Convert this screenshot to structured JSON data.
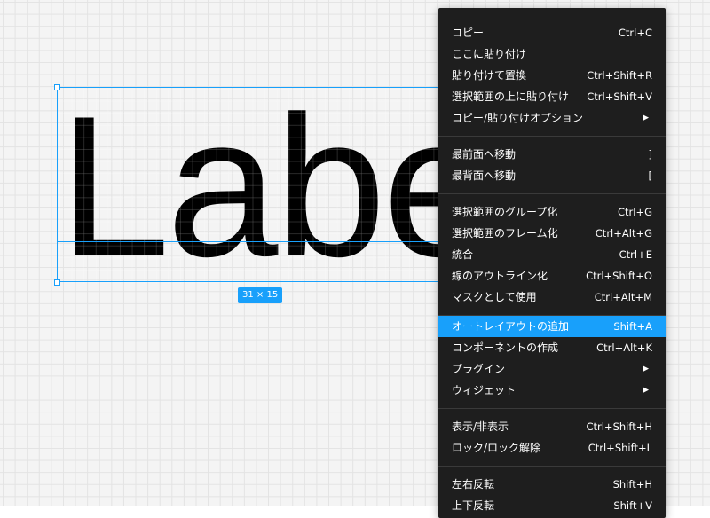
{
  "canvas": {
    "text_layer": "Label",
    "size_badge": "31 × 15",
    "selection_color": "#18a0fb"
  },
  "context_menu": {
    "highlight_color": "#18a0fb",
    "background_color": "#1e1e1e",
    "items": [
      {
        "label": "コピー",
        "shortcut": "Ctrl+C"
      },
      {
        "label": "ここに貼り付け",
        "shortcut": ""
      },
      {
        "label": "貼り付けて置換",
        "shortcut": "Ctrl+Shift+R"
      },
      {
        "label": "選択範囲の上に貼り付け",
        "shortcut": "Ctrl+Shift+V"
      },
      {
        "label": "コピー/貼り付けオプション",
        "shortcut": "",
        "submenu": true
      },
      {
        "label": "最前面へ移動",
        "shortcut": "]"
      },
      {
        "label": "最背面へ移動",
        "shortcut": "["
      },
      {
        "label": "選択範囲のグループ化",
        "shortcut": "Ctrl+G"
      },
      {
        "label": "選択範囲のフレーム化",
        "shortcut": "Ctrl+Alt+G"
      },
      {
        "label": "統合",
        "shortcut": "Ctrl+E"
      },
      {
        "label": "線のアウトライン化",
        "shortcut": "Ctrl+Shift+O"
      },
      {
        "label": "マスクとして使用",
        "shortcut": "Ctrl+Alt+M"
      },
      {
        "label": "オートレイアウトの追加",
        "shortcut": "Shift+A",
        "highlighted": true
      },
      {
        "label": "コンポーネントの作成",
        "shortcut": "Ctrl+Alt+K"
      },
      {
        "label": "プラグイン",
        "shortcut": "",
        "submenu": true
      },
      {
        "label": "ウィジェット",
        "shortcut": "",
        "submenu": true
      },
      {
        "label": "表示/非表示",
        "shortcut": "Ctrl+Shift+H"
      },
      {
        "label": "ロック/ロック解除",
        "shortcut": "Ctrl+Shift+L"
      },
      {
        "label": "左右反転",
        "shortcut": "Shift+H"
      },
      {
        "label": "上下反転",
        "shortcut": "Shift+V"
      }
    ],
    "submenu_icon": "triangle-right-icon"
  }
}
